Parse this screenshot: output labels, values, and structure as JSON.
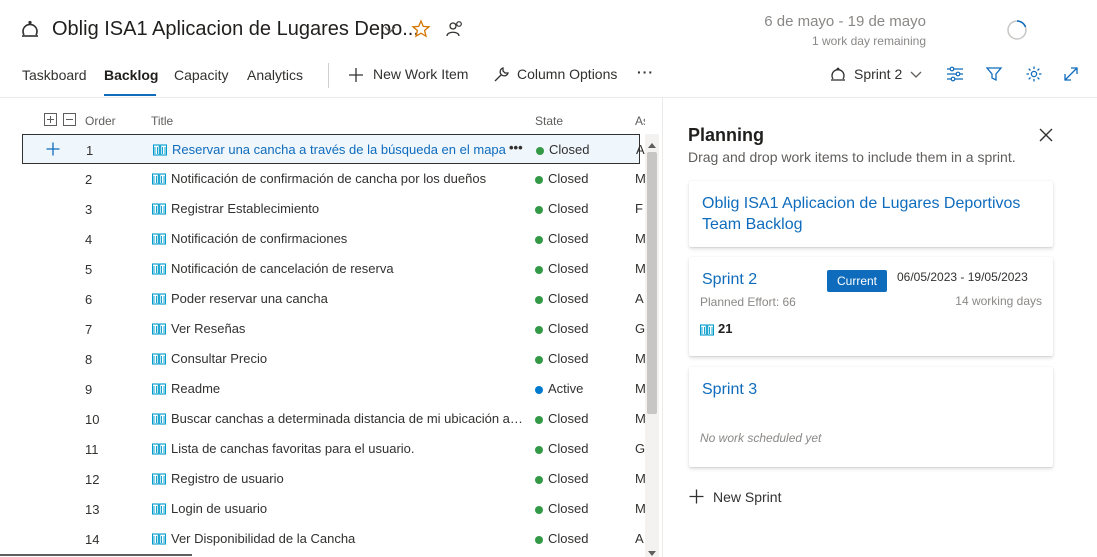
{
  "header": {
    "title": "Oblig ISA1 Aplicacion de Lugares Depo...",
    "dates": "6 de mayo - 19 de mayo",
    "remaining": "1 work day remaining"
  },
  "toolbar": {
    "tabs": [
      {
        "label": "Taskboard"
      },
      {
        "label": "Backlog"
      },
      {
        "label": "Capacity"
      },
      {
        "label": "Analytics"
      }
    ],
    "new_work_item": "New Work Item",
    "column_options": "Column Options",
    "more": "···",
    "sprint_selector": "Sprint 2"
  },
  "grid": {
    "columns": {
      "order": "Order",
      "title": "Title",
      "state": "State",
      "assigned": "Assig"
    },
    "rows": [
      {
        "order": "1",
        "title": "Reservar una cancha a través de la búsqueda en el mapa",
        "state": "Closed",
        "assigned": "A"
      },
      {
        "order": "2",
        "title": "Notificación de confirmación de cancha por los dueños",
        "state": "Closed",
        "assigned": "M"
      },
      {
        "order": "3",
        "title": "Registrar Establecimiento",
        "state": "Closed",
        "assigned": "F"
      },
      {
        "order": "4",
        "title": "Notificación de confirmaciones",
        "state": "Closed",
        "assigned": "M"
      },
      {
        "order": "5",
        "title": "Notificación de cancelación de reserva",
        "state": "Closed",
        "assigned": "M"
      },
      {
        "order": "6",
        "title": "Poder reservar una cancha",
        "state": "Closed",
        "assigned": "A"
      },
      {
        "order": "7",
        "title": "Ver Reseñas",
        "state": "Closed",
        "assigned": "G"
      },
      {
        "order": "8",
        "title": "Consultar Precio",
        "state": "Closed",
        "assigned": "M"
      },
      {
        "order": "9",
        "title": "Readme",
        "state": "Active",
        "assigned": "M"
      },
      {
        "order": "10",
        "title": "Buscar canchas a determinada distancia de mi ubicación actual",
        "state": "Closed",
        "assigned": "M"
      },
      {
        "order": "11",
        "title": "Lista de canchas favoritas para el usuario.",
        "state": "Closed",
        "assigned": "G"
      },
      {
        "order": "12",
        "title": "Registro de usuario",
        "state": "Closed",
        "assigned": "M"
      },
      {
        "order": "13",
        "title": "Login de usuario",
        "state": "Closed",
        "assigned": "M"
      },
      {
        "order": "14",
        "title": "Ver Disponibilidad de la Cancha",
        "state": "Closed",
        "assigned": "A"
      }
    ]
  },
  "planning": {
    "title": "Planning",
    "subtitle": "Drag and drop work items to include them in a sprint.",
    "backlog_card": {
      "line1": "Oblig ISA1 Aplicacion de Lugares Deportivos",
      "line2": "Team Backlog"
    },
    "sprint2": {
      "name": "Sprint 2",
      "badge": "Current",
      "dates": "06/05/2023 - 19/05/2023",
      "effort": "Planned Effort: 66",
      "days": "14 working days",
      "count": "21"
    },
    "sprint3": {
      "name": "Sprint 3",
      "empty": "No work scheduled yet"
    },
    "new_sprint": "New Sprint"
  },
  "colors": {
    "accent": "#0f6cbd",
    "closed": "#339947",
    "active": "#007acc",
    "star": "#d47500"
  }
}
